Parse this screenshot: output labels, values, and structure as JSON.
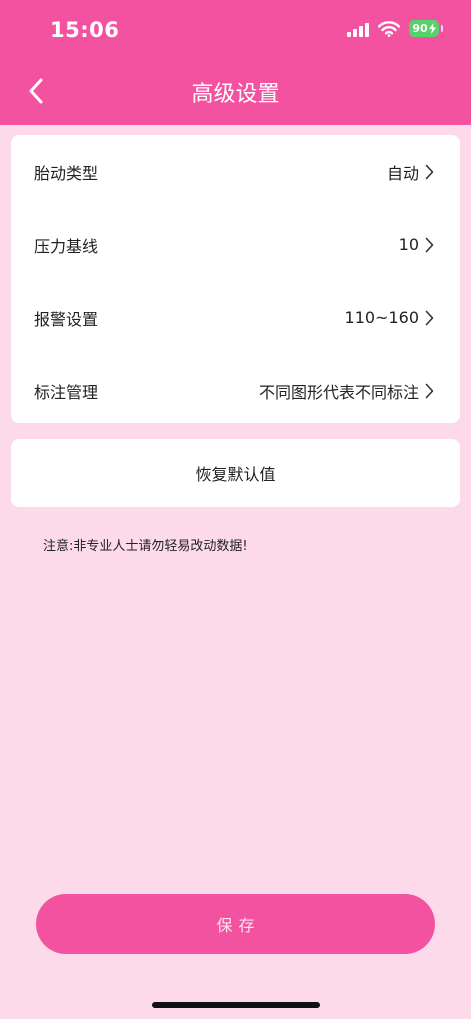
{
  "status_bar": {
    "time": "15:06",
    "battery": "90",
    "icons": [
      "signal-icon",
      "wifi-icon",
      "battery-charging-icon"
    ],
    "battery_color": "#56d26a"
  },
  "header": {
    "title": "高级设置",
    "back_icon": "chevron-left-icon",
    "background": "#f352a1"
  },
  "settings": {
    "items": [
      {
        "label": "胎动类型",
        "value": "自动"
      },
      {
        "label": "压力基线",
        "value": "10"
      },
      {
        "label": "报警设置",
        "value": "110~160"
      },
      {
        "label": "标注管理",
        "value": "不同图形代表不同标注"
      }
    ]
  },
  "reset": {
    "label": "恢复默认值"
  },
  "notice": "注意:非专业人士请勿轻易改动数据!",
  "save": {
    "label": "保存",
    "color": "#f352a1"
  },
  "page_background": "#fcdaea"
}
